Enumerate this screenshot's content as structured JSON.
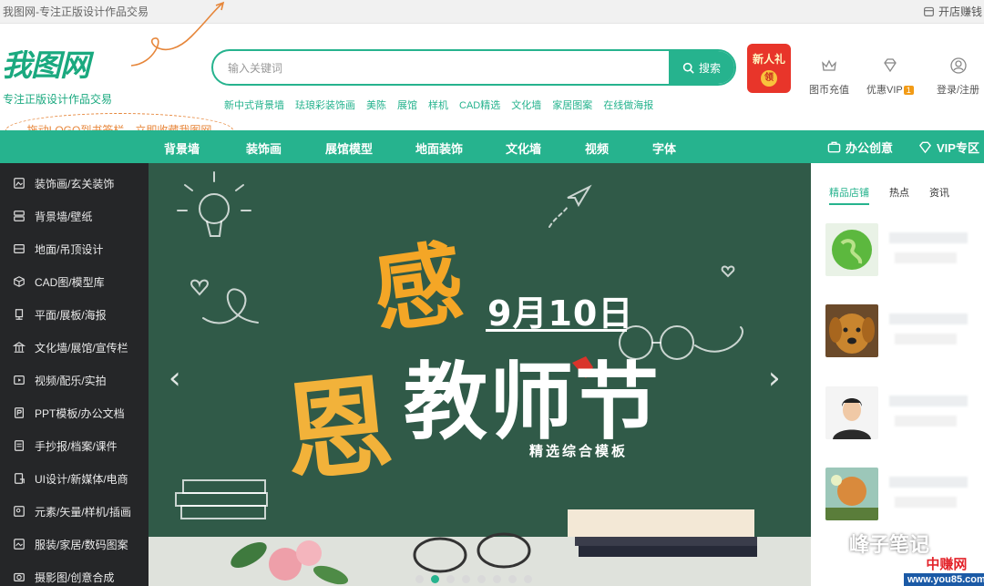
{
  "browser_tab": {
    "title": "我图网-专注正版设计作品交易",
    "shop_link": "开店赚钱"
  },
  "logo": {
    "text": "我图网",
    "slogan": "专注正版设计作品交易"
  },
  "bookmark_tip": "拖动LOGO到书签栏，立即收藏我图网",
  "search": {
    "placeholder": "输入关键词",
    "button": "搜索"
  },
  "hot_words": [
    "新中式背景墙",
    "珐琅彩装饰画",
    "美陈",
    "展馆",
    "样机",
    "CAD精选",
    "文化墙",
    "家居图案",
    "在线做海报"
  ],
  "gift": {
    "line1": "新人礼",
    "seal": "领"
  },
  "header_icons": {
    "recharge": "图币充值",
    "vip": "优惠VIP",
    "vip_badge": "1",
    "login": "登录/注册"
  },
  "nav": {
    "items": [
      "背景墙",
      "装饰画",
      "展馆模型",
      "地面装饰",
      "文化墙",
      "视频",
      "字体"
    ],
    "office": "办公创意",
    "vip_zone": "VIP专区"
  },
  "sidebar": [
    {
      "label": "装饰画/玄关装饰",
      "icon": "picture-icon"
    },
    {
      "label": "背景墙/壁纸",
      "icon": "wallpaper-icon"
    },
    {
      "label": "地面/吊顶设计",
      "icon": "floor-icon"
    },
    {
      "label": "CAD图/模型库",
      "icon": "cube-icon"
    },
    {
      "label": "平面/展板/海报",
      "icon": "poster-icon"
    },
    {
      "label": "文化墙/展馆/宣传栏",
      "icon": "building-icon"
    },
    {
      "label": "视频/配乐/实拍",
      "icon": "video-icon"
    },
    {
      "label": "PPT模板/办公文档",
      "icon": "ppt-icon"
    },
    {
      "label": "手抄报/档案/课件",
      "icon": "document-icon"
    },
    {
      "label": "UI设计/新媒体/电商",
      "icon": "ui-icon"
    },
    {
      "label": "元素/矢量/样机/插画",
      "icon": "element-icon"
    },
    {
      "label": "服装/家居/数码图案",
      "icon": "pattern-icon"
    },
    {
      "label": "摄影图/创意合成",
      "icon": "camera-icon"
    }
  ],
  "banner": {
    "char1": "感",
    "char2": "恩",
    "date": "9月10日",
    "title": "教师节",
    "tagline": "精选综合模板",
    "slide_count": 8,
    "active_slide": 1
  },
  "right_panel": {
    "tabs": [
      "精品店铺",
      "热点",
      "资讯"
    ],
    "active_tab": 0,
    "shop_thumbs": [
      "globe-thumb",
      "dog-thumb",
      "person-thumb",
      "illustration-thumb"
    ]
  },
  "watermark": {
    "text": "峰子笔记",
    "site_name": "中赚网",
    "site_url": "www.you85.com"
  },
  "colors": {
    "brand_green": "#26b38e",
    "sidebar_bg": "#252628",
    "banner_bg": "#305a48",
    "gift_red": "#e8352a",
    "tip_orange": "#e6863a"
  }
}
